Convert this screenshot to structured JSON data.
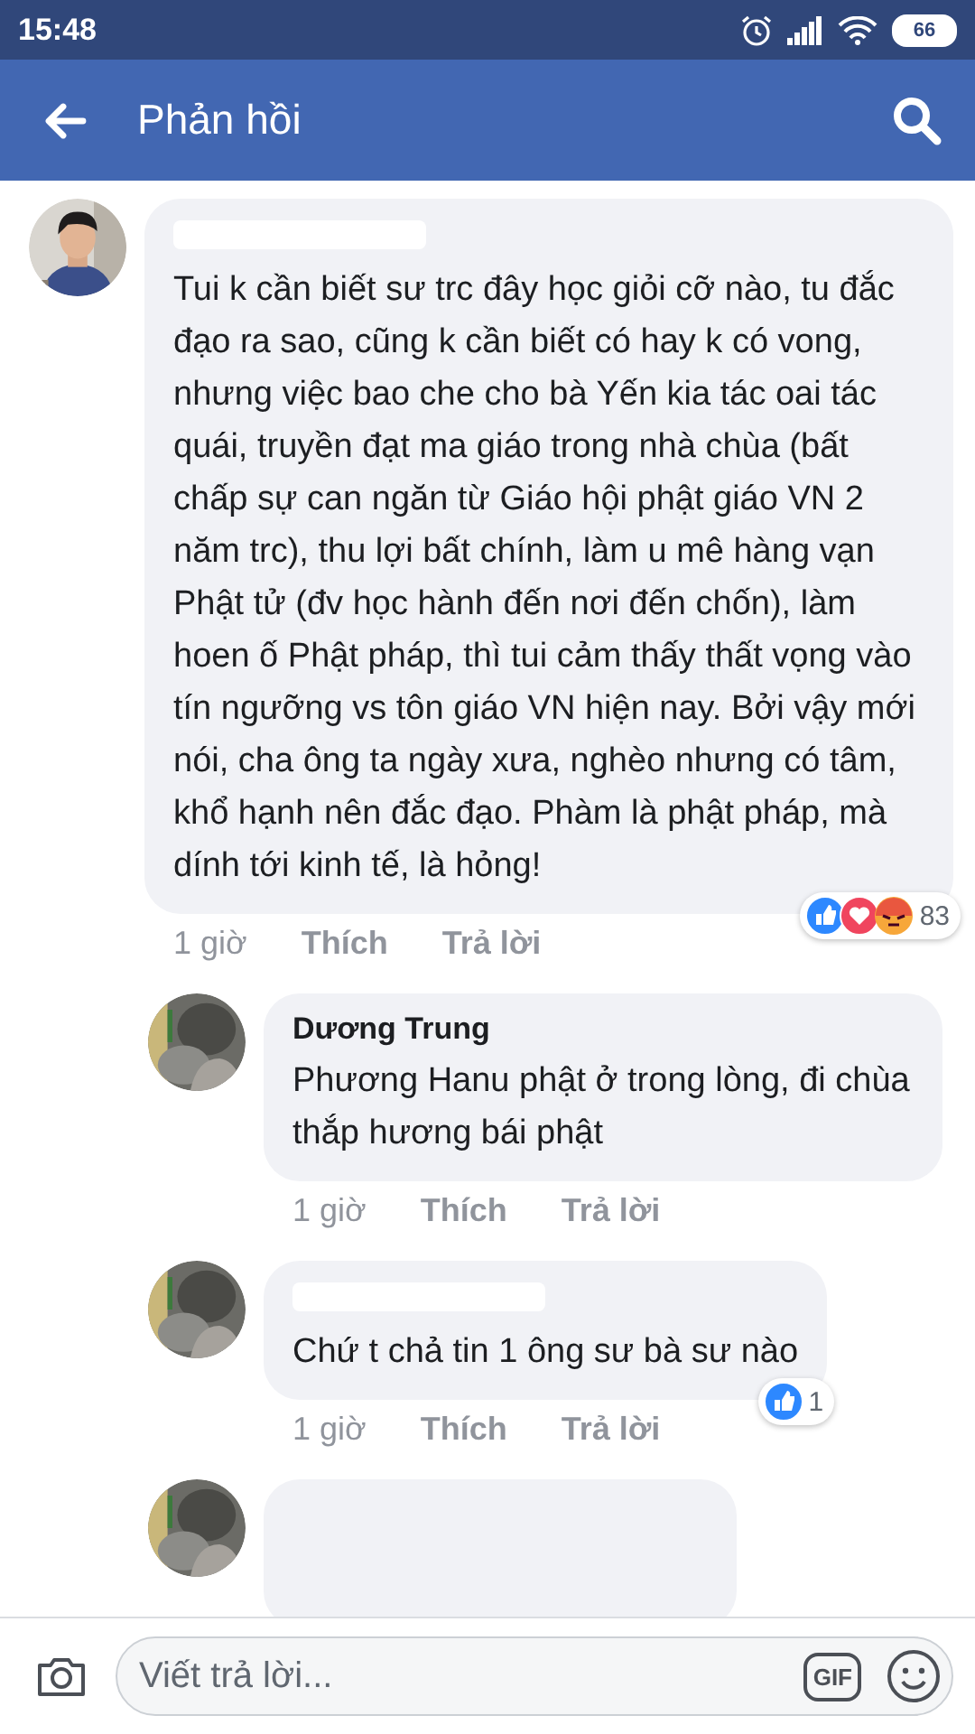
{
  "status_bar": {
    "time": "15:48",
    "battery": "66"
  },
  "header": {
    "title": "Phản hồi"
  },
  "comment": {
    "text": "Tui k cần biết sư trc đây học giỏi cỡ nào, tu đắc đạo ra sao, cũng k cần biết có hay k có vong, nhưng việc bao che cho bà Yến kia tác oai tác quái, truyền đạt ma giáo trong nhà chùa (bất chấp sự can ngăn từ Giáo hội phật giáo VN 2 năm trc), thu lợi bất chính, làm u mê hàng vạn Phật tử (đv học hành đến nơi đến chốn), làm hoen ố Phật pháp, thì tui cảm thấy thất vọng vào tín ngưỡng vs tôn giáo VN hiện nay. Bởi vậy mới nói, cha ông ta ngày xưa, nghèo nhưng có tâm, khổ hạnh nên đắc đạo. Phàm là phật pháp, mà dính tới kinh tế, là hỏng!",
    "time": "1 giờ",
    "like_label": "Thích",
    "reply_label": "Trả lời",
    "reactions": [
      {
        "kind": "like"
      },
      {
        "kind": "love"
      },
      {
        "kind": "angry"
      }
    ],
    "reaction_count": "83",
    "replies": [
      {
        "kind": "full",
        "author": "Dương Trung",
        "text": "Phương Hanu phật ở trong lòng, đi chùa thắp hương bái phật",
        "time": "1 giờ",
        "like_label": "Thích",
        "reply_label": "Trả lời"
      },
      {
        "kind": "full",
        "text": "Chứ t chả tin 1 ông sư bà sư nào",
        "time": "1 giờ",
        "like_label": "Thích",
        "reply_label": "Trả lời",
        "reactions": [
          {
            "kind": "like"
          }
        ],
        "reaction_count": "1"
      },
      {
        "kind": "clipped"
      }
    ]
  },
  "composer": {
    "placeholder": "Viết trả lời...",
    "gif_label": "GIF"
  }
}
